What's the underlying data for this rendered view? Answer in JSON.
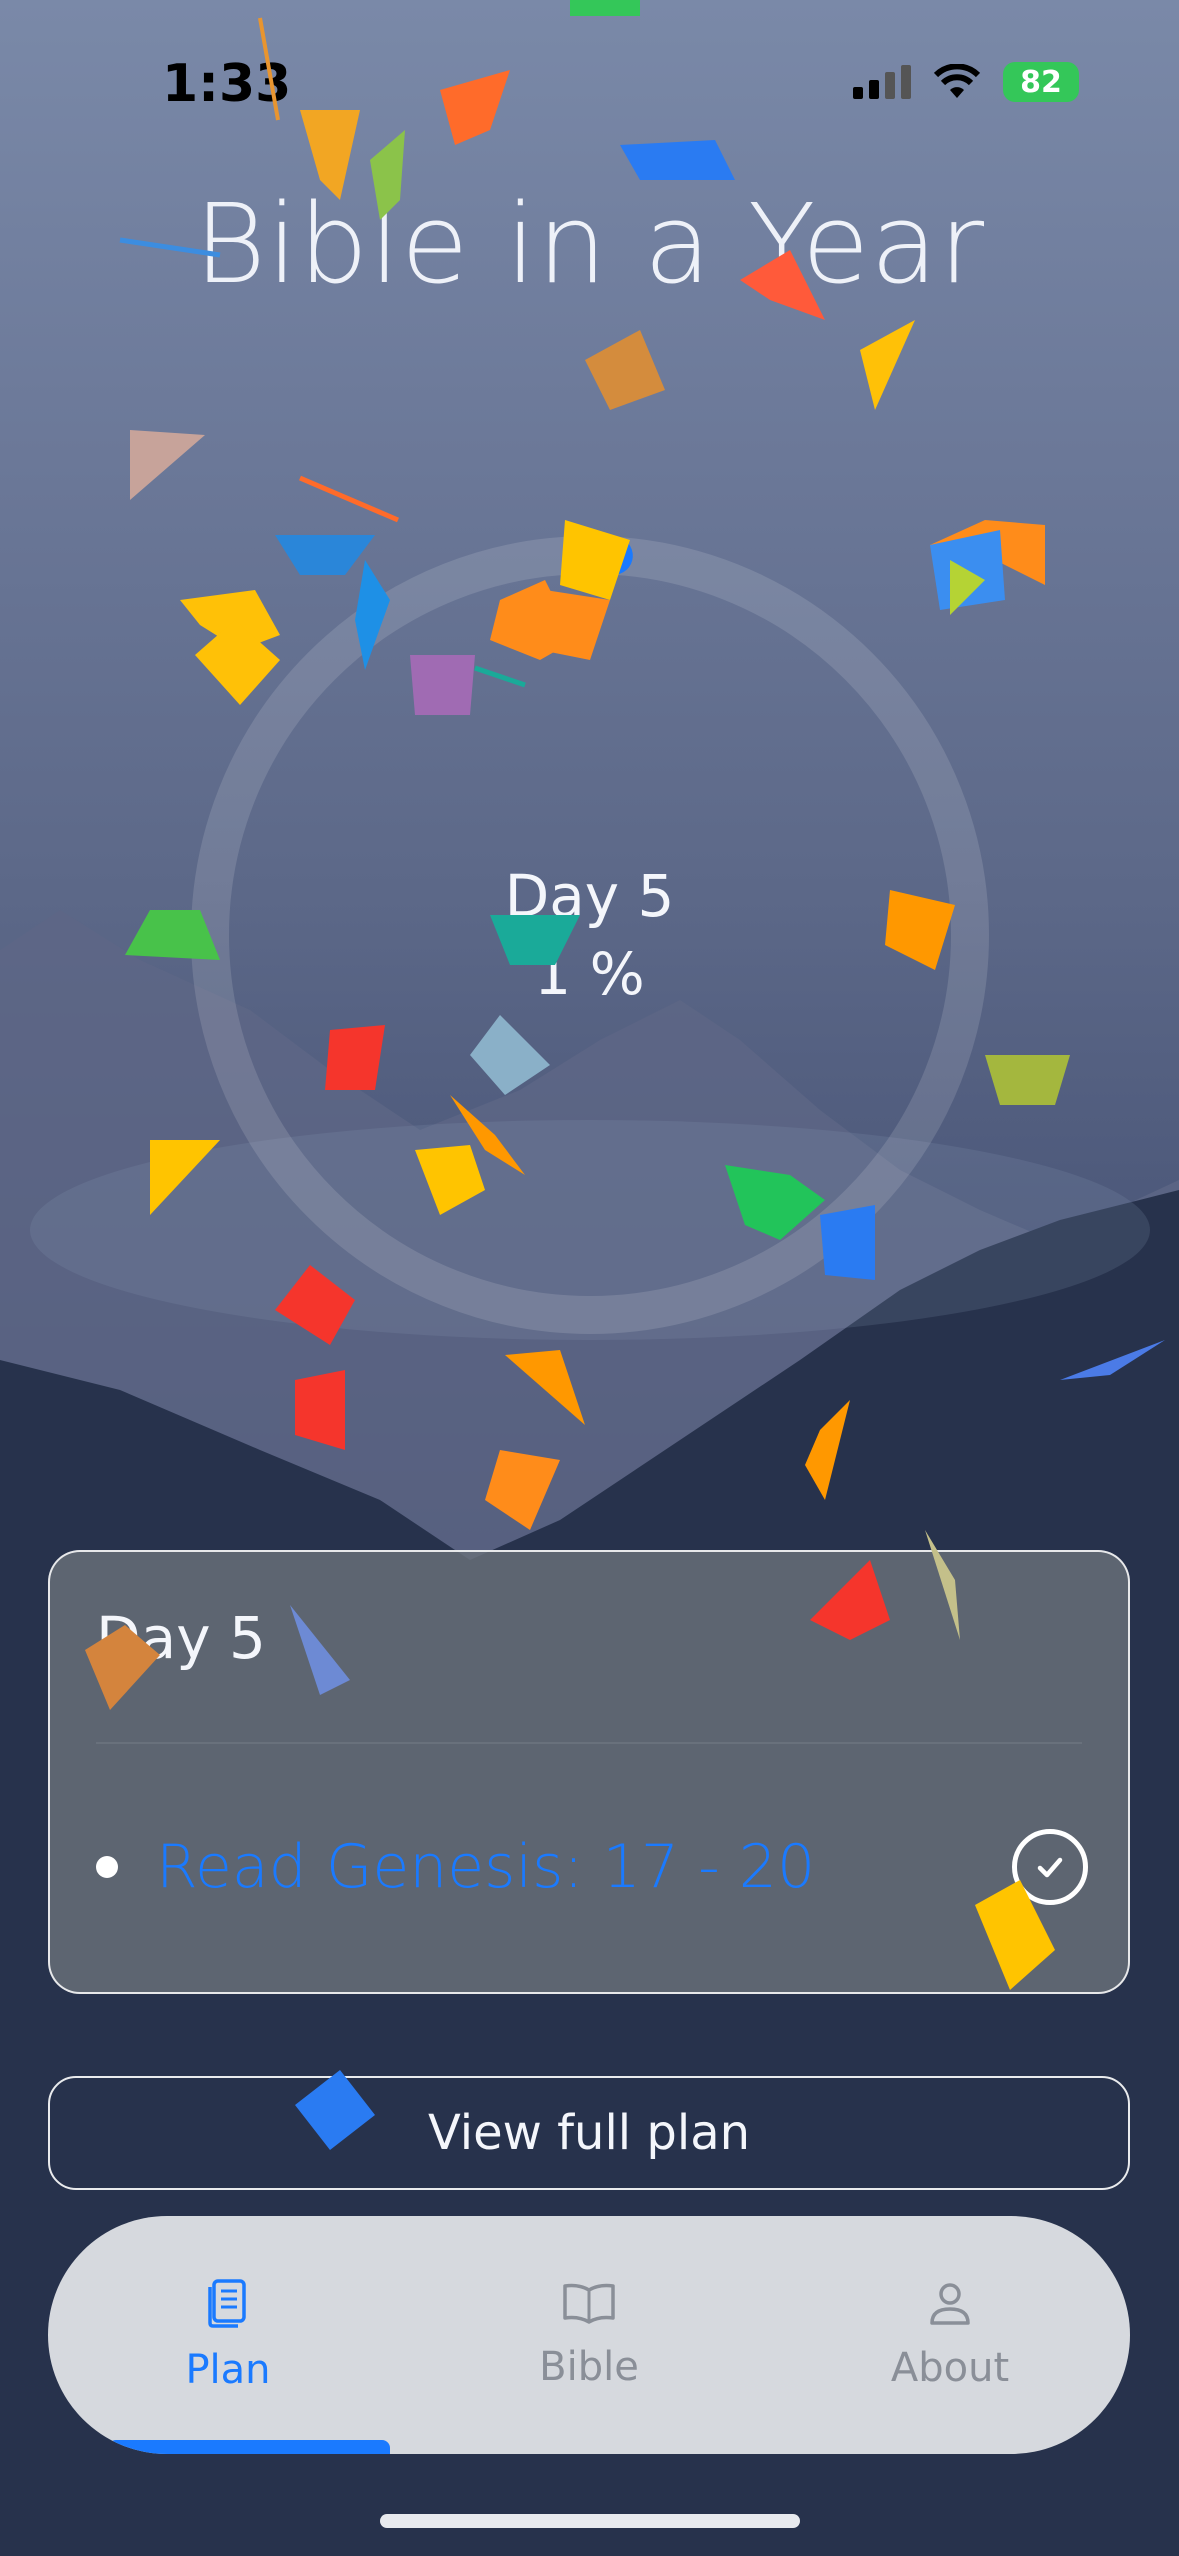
{
  "status_bar": {
    "time": "1:33",
    "battery": "82"
  },
  "app": {
    "title": "Bible in a Year"
  },
  "progress": {
    "day_label": "Day 5",
    "percent_label": "1 %",
    "percent_value": 1
  },
  "today_card": {
    "title": "Day 5",
    "readings": [
      {
        "label": "Read Genesis: 17 - 20",
        "completed": true
      }
    ]
  },
  "view_plan_label": "View full plan",
  "tabs": [
    {
      "label": "Plan",
      "icon": "plan-book-icon",
      "active": true
    },
    {
      "label": "Bible",
      "icon": "open-book-icon",
      "active": false
    },
    {
      "label": "About",
      "icon": "person-icon",
      "active": false
    }
  ],
  "colors": {
    "accent": "#1a7aff",
    "battery": "#34c759"
  }
}
